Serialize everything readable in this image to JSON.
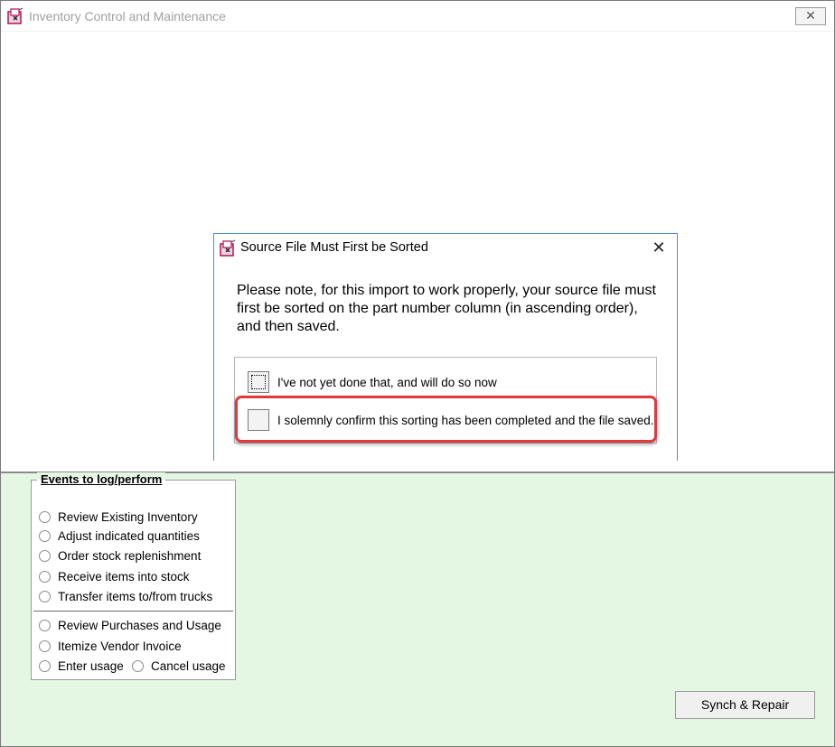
{
  "window": {
    "title": "Inventory Control and Maintenance",
    "close_symbol": "✕",
    "icon": "app-icon"
  },
  "dialog": {
    "title": "Source File Must First be Sorted",
    "close_symbol": "✕",
    "message": "Please note, for this import to work properly, your source file must first be sorted on the part number column (in ascending order), and then saved.",
    "options": [
      {
        "label": "I've not yet done that, and will do so now",
        "focused": true
      },
      {
        "label": "I solemnly confirm this sorting has been completed and the file saved.",
        "focused": false
      }
    ],
    "highlight_color": "#e0393e"
  },
  "events": {
    "legend": "Events to log/perform",
    "items": [
      "Review Existing Inventory",
      "Adjust indicated quantities",
      "Order stock replenishment",
      "Receive items into stock",
      "Transfer items to/from trucks",
      "Review Purchases and Usage",
      "Itemize Vendor Invoice",
      "Enter usage",
      "Cancel usage"
    ]
  },
  "synch_button": {
    "label": "Synch & Repair"
  },
  "colors": {
    "panel_background": "#e3f7e3",
    "dialog_border": "#4a90d9"
  }
}
